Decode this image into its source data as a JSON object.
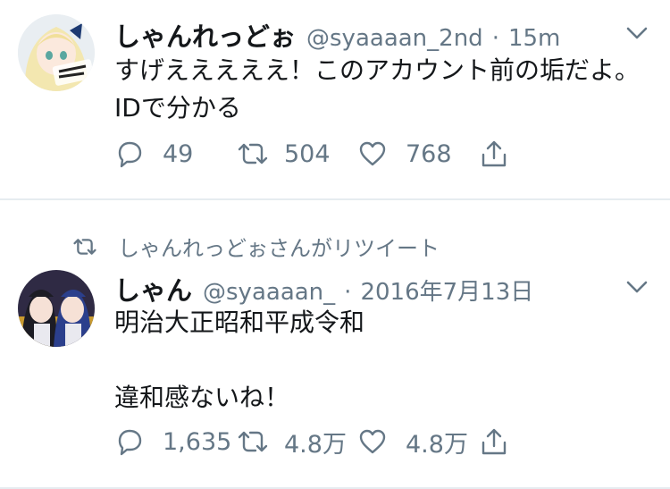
{
  "tweets": [
    {
      "name": "しゃんれっどぉ",
      "handle": "@syaaaan_2nd",
      "separator": "·",
      "time": "15m",
      "text": "すげえええええ！このアカウント前の垢だよ。IDで分かる",
      "replies": "49",
      "retweets": "504",
      "likes": "768"
    },
    {
      "retweet_context": "しゃんれっどぉさんがリツイート",
      "name": "しゃん",
      "handle": "@syaaaan_",
      "separator": "·",
      "time": "2016年7月13日",
      "text": "明治大正昭和平成令和\n\n違和感ないね！",
      "replies": "1,635",
      "retweets": "4.8万",
      "likes": "4.8万"
    }
  ],
  "colors": {
    "text": "#14171a",
    "secondary": "#657786",
    "divider": "#e6ecf0"
  },
  "icons": [
    "reply-icon",
    "retweet-icon",
    "like-icon",
    "share-icon",
    "chevron-down-icon",
    "retweet-context-icon"
  ]
}
